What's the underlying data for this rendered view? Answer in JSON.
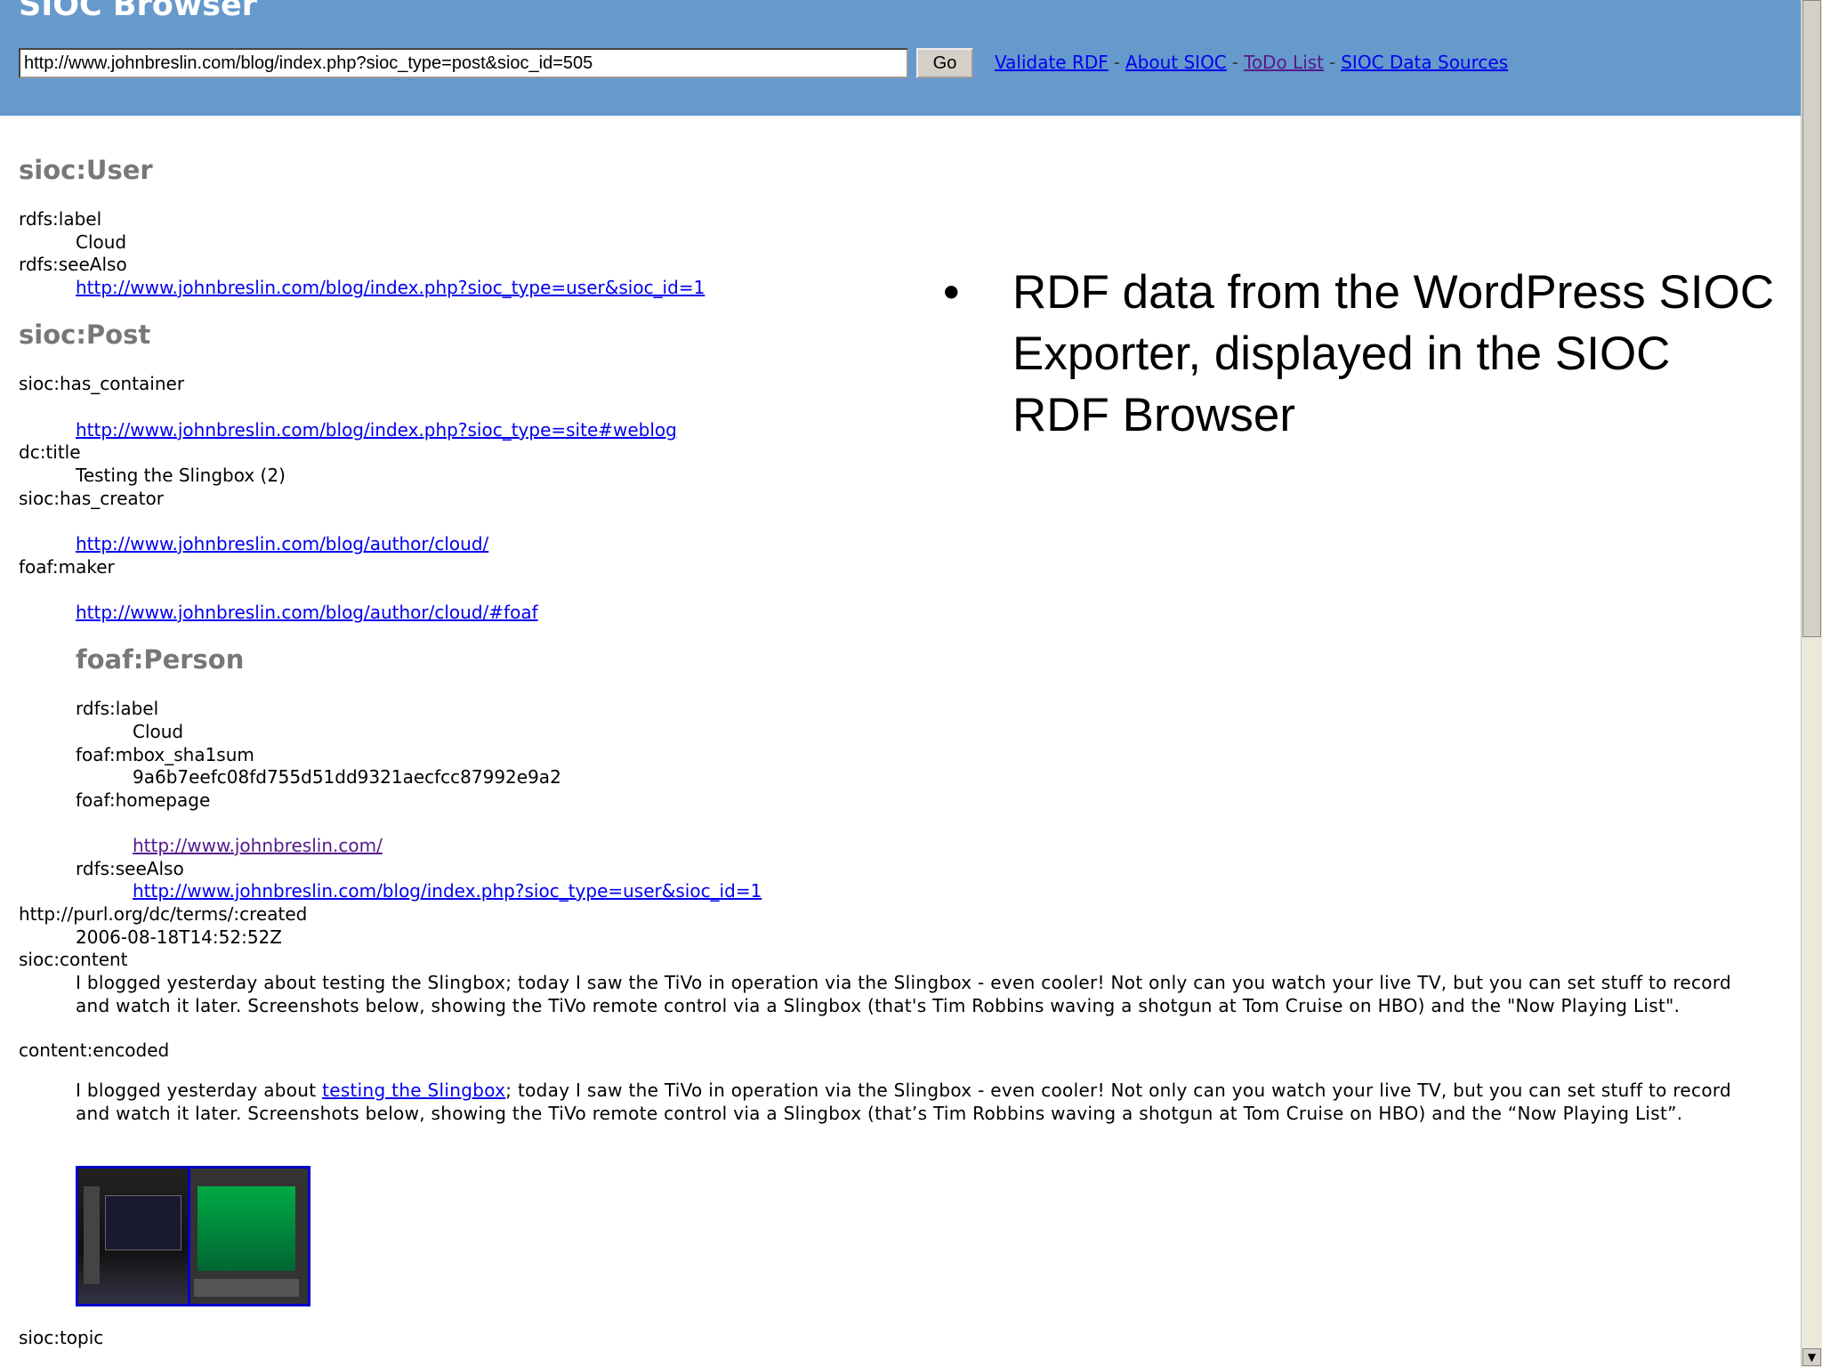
{
  "header": {
    "title": "SIOC Browser",
    "url_value": "http://www.johnbreslin.com/blog/index.php?sioc_type=post&sioc_id=505",
    "go_label": "Go",
    "links": [
      "Validate RDF",
      "About SIOC",
      "ToDo List",
      "SIOC Data Sources"
    ],
    "separator": "-",
    "background_color": "#6699cc"
  },
  "user": {
    "class": "sioc:User",
    "label_key": "rdfs:label",
    "label_value": "Cloud",
    "seealso_key": "rdfs:seeAlso",
    "seealso_value": "http://www.johnbreslin.com/blog/index.php?sioc_type=user&sioc_id=1"
  },
  "post": {
    "class": "sioc:Post",
    "has_container_key": "sioc:has_container",
    "has_container_value": "http://www.johnbreslin.com/blog/index.php?sioc_type=site#weblog",
    "title_key": "dc:title",
    "title_value": "Testing the Slingbox (2)",
    "has_creator_key": "sioc:has_creator",
    "has_creator_value": "http://www.johnbreslin.com/blog/author/cloud/",
    "maker_key": "foaf:maker",
    "maker_value": "http://www.johnbreslin.com/blog/author/cloud/#foaf",
    "created_key": "http://purl.org/dc/terms/:created",
    "created_value": "2006-08-18T14:52:52Z",
    "content_key": "sioc:content",
    "content_value": "I blogged yesterday about testing the Slingbox; today I saw the TiVo in operation via the Slingbox - even cooler! Not only can you watch your live TV, but you can set stuff to record and watch it later. Screenshots below, showing the TiVo remote control via a Slingbox (that's Tim Robbins waving a shotgun at Tom Cruise on HBO) and the \"Now Playing List\".",
    "encoded_key": "content:encoded",
    "encoded_before": "I blogged yesterday about ",
    "encoded_link": "testing the Slingbox",
    "encoded_after": "; today I saw the TiVo in operation via the Slingbox - even cooler! Not only can you watch your live TV, but you can set stuff to record and watch it later. Screenshots below, showing the TiVo remote control via a Slingbox (that’s Tim Robbins waving a shotgun at Tom Cruise on HBO) and the “Now Playing List”.",
    "topic_key": "sioc:topic"
  },
  "person": {
    "class": "foaf:Person",
    "label_key": "rdfs:label",
    "label_value": "Cloud",
    "mbox_key": "foaf:mbox_sha1sum",
    "mbox_value": "9a6b7eefc08fd755d51dd9321aecfcc87992e9a2",
    "homepage_key": "foaf:homepage",
    "homepage_value": "http://www.johnbreslin.com/",
    "seealso_key": "rdfs:seeAlso",
    "seealso_value": "http://www.johnbreslin.com/blog/index.php?sioc_type=user&sioc_id=1"
  },
  "overlay": {
    "bullet": "•",
    "text": "RDF data from the WordPress SIOC Exporter, displayed in the SIOC RDF Browser"
  }
}
